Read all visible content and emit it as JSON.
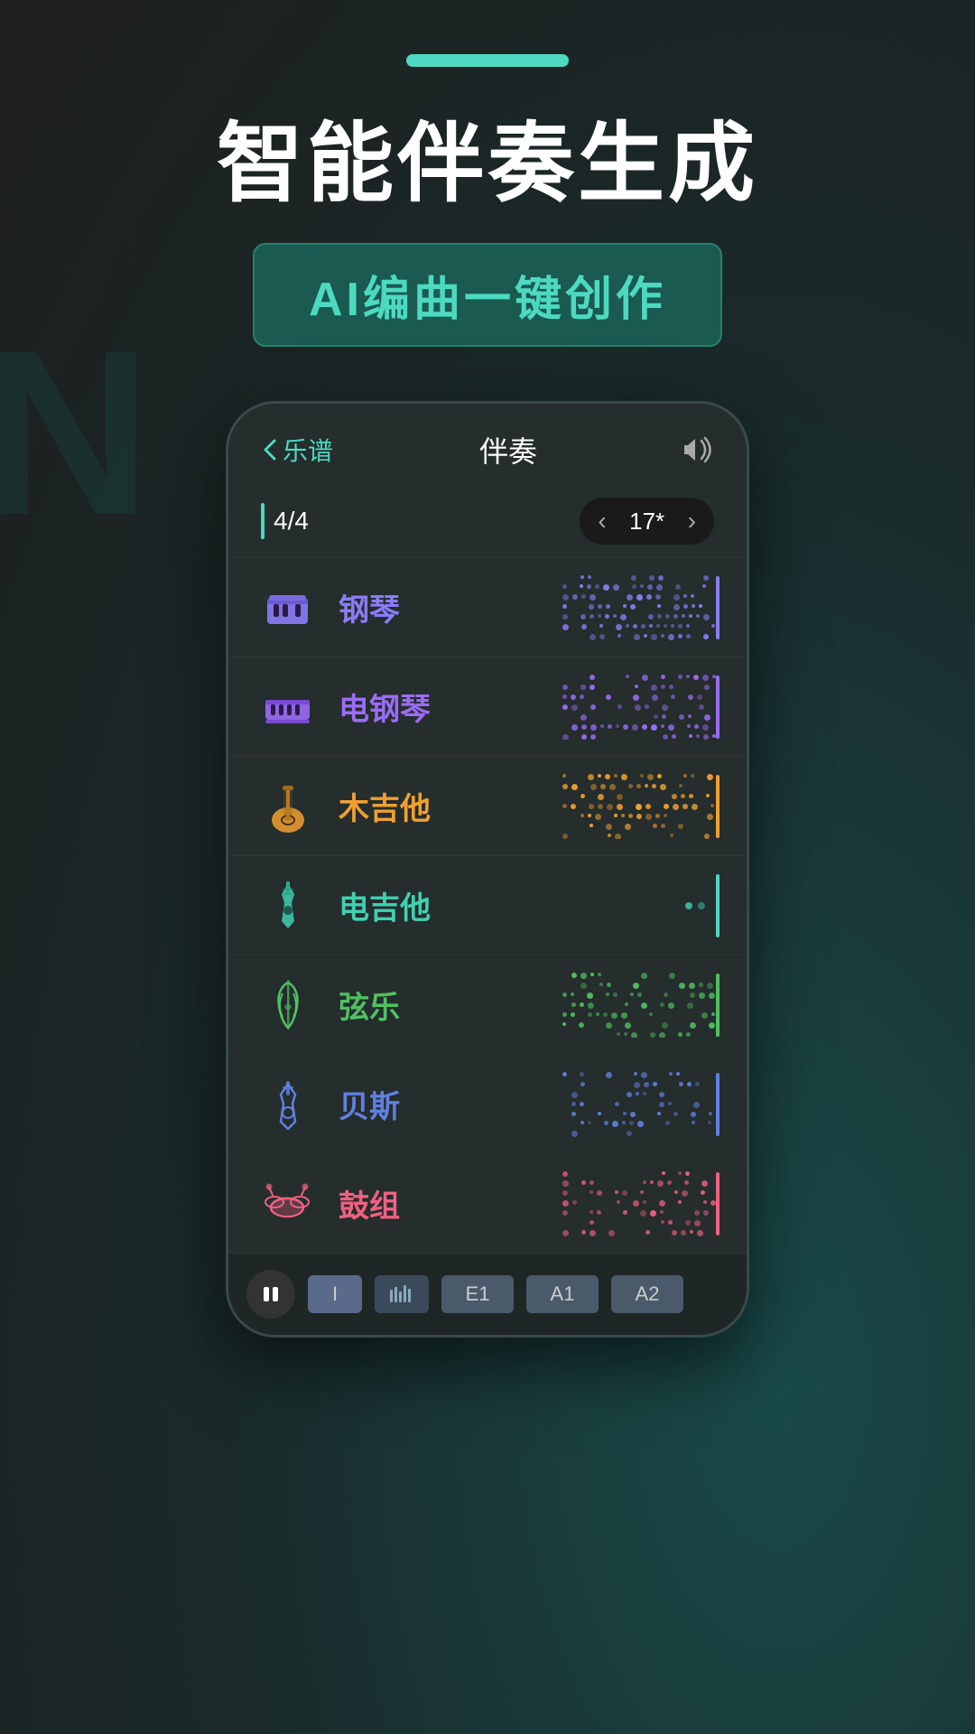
{
  "page": {
    "background_color": "#1a2a2a"
  },
  "top_badge": {
    "visible": true
  },
  "hero": {
    "main_title": "智能伴奏生成",
    "subtitle": "AI编曲一键创作"
  },
  "phone": {
    "nav": {
      "back_label": "乐谱",
      "title": "伴奏",
      "sound_icon": "🔊"
    },
    "time_signature": {
      "value": "4/4",
      "tempo": "17*"
    },
    "instruments": [
      {
        "id": "piano",
        "name": "钢琴",
        "color": "#8b7cf6",
        "track_color": "#8b7cf6",
        "has_pattern": true,
        "dot_color": "#8b7cf6"
      },
      {
        "id": "epiano",
        "name": "电钢琴",
        "color": "#9b6cf6",
        "track_color": "#9b6cf6",
        "has_pattern": true,
        "dot_color": "#9b6cf6"
      },
      {
        "id": "guitar",
        "name": "木吉他",
        "color": "#f0a030",
        "track_color": "#f0a030",
        "has_pattern": true,
        "dot_color": "#f0a030"
      },
      {
        "id": "eguitar",
        "name": "电吉他",
        "color": "#40d0b0",
        "track_color": "#4dd9c0",
        "has_pattern": false,
        "dot_color": "#40d0b0"
      },
      {
        "id": "strings",
        "name": "弦乐",
        "color": "#50c060",
        "track_color": "#50c060",
        "has_pattern": true,
        "dot_color": "#50c060"
      },
      {
        "id": "bass",
        "name": "贝斯",
        "color": "#6080e0",
        "track_color": "#6080e0",
        "has_pattern": true,
        "dot_color": "#6080e0"
      },
      {
        "id": "drums",
        "name": "鼓组",
        "color": "#f06080",
        "track_color": "#f06080",
        "has_pattern": true,
        "dot_color": "#f06080"
      }
    ],
    "bottom_player": {
      "segments": [
        "I",
        "E1",
        "A1",
        "A2"
      ]
    }
  }
}
